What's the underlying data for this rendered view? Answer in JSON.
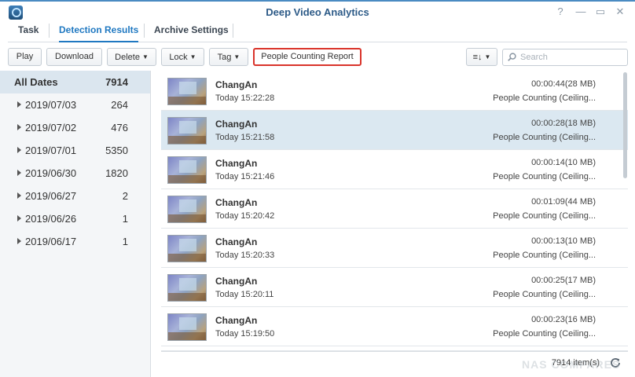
{
  "window": {
    "title": "Deep Video Analytics",
    "help_icon": "?",
    "min_icon": "—",
    "max_icon": "▭",
    "close_icon": "✕"
  },
  "tabs": [
    {
      "label": "Task"
    },
    {
      "label": "Detection Results"
    },
    {
      "label": "Archive Settings"
    }
  ],
  "toolbar": {
    "play": "Play",
    "download": "Download",
    "delete": "Delete",
    "lock": "Lock",
    "tag": "Tag",
    "report": "People Counting Report",
    "caret": "▼",
    "sort_icon": "≡↓",
    "search_placeholder": "Search"
  },
  "sidebar": {
    "all": {
      "label": "All Dates",
      "count": "7914"
    },
    "dates": [
      {
        "label": "2019/07/03",
        "count": "264"
      },
      {
        "label": "2019/07/02",
        "count": "476"
      },
      {
        "label": "2019/07/01",
        "count": "5350"
      },
      {
        "label": "2019/06/30",
        "count": "1820"
      },
      {
        "label": "2019/06/27",
        "count": "2"
      },
      {
        "label": "2019/06/26",
        "count": "1"
      },
      {
        "label": "2019/06/17",
        "count": "1"
      }
    ]
  },
  "results": [
    {
      "name": "ChangAn",
      "time": "Today 15:22:28",
      "duration": "00:00:44(28 MB)",
      "type": "People Counting (Ceiling..."
    },
    {
      "name": "ChangAn",
      "time": "Today 15:21:58",
      "duration": "00:00:28(18 MB)",
      "type": "People Counting (Ceiling..."
    },
    {
      "name": "ChangAn",
      "time": "Today 15:21:46",
      "duration": "00:00:14(10 MB)",
      "type": "People Counting (Ceiling..."
    },
    {
      "name": "ChangAn",
      "time": "Today 15:20:42",
      "duration": "00:01:09(44 MB)",
      "type": "People Counting (Ceiling..."
    },
    {
      "name": "ChangAn",
      "time": "Today 15:20:33",
      "duration": "00:00:13(10 MB)",
      "type": "People Counting (Ceiling..."
    },
    {
      "name": "ChangAn",
      "time": "Today 15:20:11",
      "duration": "00:00:25(17 MB)",
      "type": "People Counting (Ceiling..."
    },
    {
      "name": "ChangAn",
      "time": "Today 15:19:50",
      "duration": "00:00:23(16 MB)",
      "type": "People Counting (Ceiling..."
    }
  ],
  "status": {
    "items": "7914 item(s)"
  },
  "watermark": "NAS COMPARES",
  "colors": {
    "accent": "#1f78c1",
    "selected_row": "#dbe8f1",
    "highlight_border": "#d9342b"
  }
}
